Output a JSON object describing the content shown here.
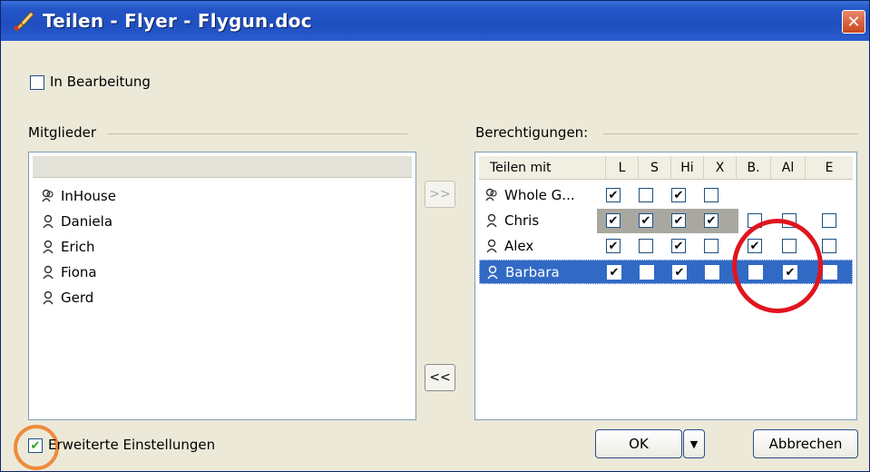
{
  "window": {
    "title": "Teilen - Flyer - Flygun.doc",
    "close_label": "✕"
  },
  "in_bearbeitung": {
    "label": "In Bearbeitung",
    "checked": false
  },
  "members": {
    "group_label": "Mitglieder",
    "items": [
      "InHouse",
      "Daniela",
      "Erich",
      "Fiona",
      "Gerd"
    ]
  },
  "buttons": {
    "add": ">>",
    "remove": "<<",
    "ok": "OK",
    "ok_dropdown": "▼",
    "cancel": "Abbrechen"
  },
  "permissions": {
    "group_label": "Berechtigungen:",
    "columns": [
      "Teilen mit",
      "L",
      "S",
      "Hi",
      "X",
      "B.",
      "Al",
      "E"
    ],
    "rows": [
      {
        "name": "Whole G...",
        "checks": [
          true,
          false,
          true,
          false,
          null,
          null,
          null
        ]
      },
      {
        "name": "Chris",
        "checks": [
          true,
          true,
          true,
          true,
          false,
          false,
          false
        ]
      },
      {
        "name": "Alex",
        "checks": [
          true,
          false,
          true,
          false,
          true,
          false,
          false
        ]
      },
      {
        "name": "Barbara",
        "checks": [
          true,
          false,
          true,
          false,
          false,
          true,
          false
        ],
        "selected": true
      }
    ]
  },
  "advanced": {
    "label": "Erweiterte Einstellungen",
    "checked": true
  },
  "colors": {
    "titlebar": "#1f4fbf",
    "dialog_bg": "#ece9d8",
    "selection": "#316ac5",
    "highlight_red": "#e0151f",
    "highlight_orange": "#f08a3b"
  }
}
